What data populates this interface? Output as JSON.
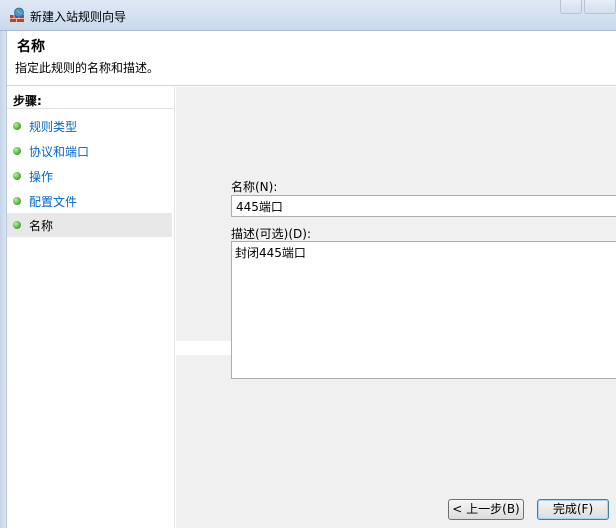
{
  "window": {
    "title": "新建入站规则向导",
    "icon": "firewall-icon"
  },
  "header": {
    "title": "名称",
    "subtitle": "指定此规则的名称和描述。"
  },
  "steps": {
    "header": "步骤:",
    "items": [
      {
        "label": "规则类型",
        "state": "completed"
      },
      {
        "label": "协议和端口",
        "state": "completed"
      },
      {
        "label": "操作",
        "state": "completed"
      },
      {
        "label": "配置文件",
        "state": "completed"
      },
      {
        "label": "名称",
        "state": "current"
      }
    ]
  },
  "form": {
    "name_label": "名称(N):",
    "name_value": "445端口",
    "desc_label": "描述(可选)(D):",
    "desc_value": "封闭445端口"
  },
  "buttons": {
    "back": "< 上一步(B)",
    "finish": "完成(F)"
  },
  "colors": {
    "link": "#0066cc",
    "content_bg": "#f0f0f0",
    "step_dot": "#3fa62a"
  }
}
